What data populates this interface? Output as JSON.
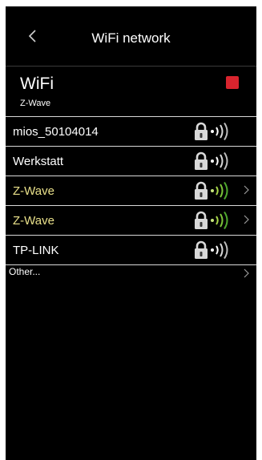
{
  "header": {
    "title": "WiFi network",
    "back_icon": "chevron-left-icon"
  },
  "wifi": {
    "label": "WiFi",
    "connected": "Z-Wave",
    "enabled": true,
    "checkbox_color": "#d8242e"
  },
  "networks": [
    {
      "name": "mios_50104014",
      "secured": true,
      "color": "#ffffff",
      "chevron": false
    },
    {
      "name": "Werkstatt",
      "secured": true,
      "color": "#ffffff",
      "chevron": false
    },
    {
      "name": "Z-Wave",
      "secured": true,
      "color": "#e9e08a",
      "chevron": true
    },
    {
      "name": "Z-Wave",
      "secured": true,
      "color": "#e9e08a",
      "chevron": true
    },
    {
      "name": "TP-LINK",
      "secured": true,
      "color": "#ffffff",
      "chevron": false
    }
  ],
  "other": {
    "label": "Other..."
  }
}
